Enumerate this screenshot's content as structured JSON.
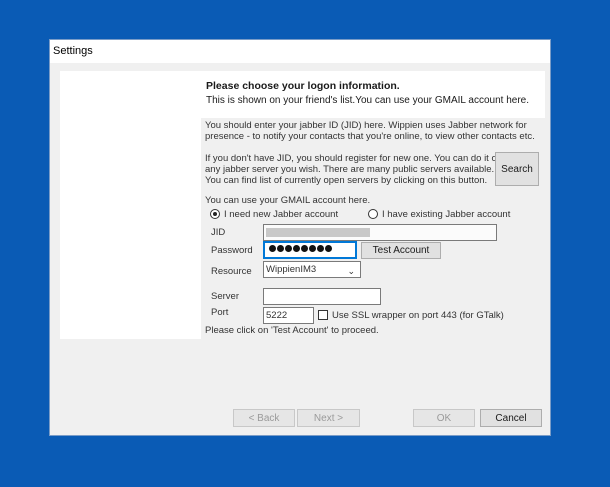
{
  "window": {
    "title": "Settings"
  },
  "header": {
    "title": "Please choose your logon information.",
    "subtitle": "This is shown on your friend's list.You can use your GMAIL account here."
  },
  "intro": {
    "line1": "You should enter your jabber ID (JID) here. Wippien uses Jabber network for",
    "line2": "presence - to notify your contacts that you're online, to view other contacts etc."
  },
  "register": {
    "line1": "If you don't have JID, you should register for new one. You can do it on",
    "line2": "any jabber server you wish. There are many public servers available.",
    "line3": "You can find list of currently open servers by clicking on this button.",
    "search_label": "Search"
  },
  "gmail_note": "You can use your GMAIL account here.",
  "account_choice": {
    "new_label": "I need new Jabber account",
    "existing_label": "I have existing Jabber account",
    "selected": "new"
  },
  "form": {
    "jid_label": "JID",
    "jid_value": "",
    "password_label": "Password",
    "password_length": 8,
    "test_account_label": "Test Account",
    "resource_label": "Resource",
    "resource_value": "WippienIM3",
    "server_label": "Server",
    "server_value": "",
    "port_label": "Port",
    "port_value": "5222",
    "ssl_label": "Use SSL wrapper on port 443 (for GTalk)",
    "ssl_checked": false,
    "hint": "Please click on 'Test Account' to proceed."
  },
  "footer": {
    "back_label": "< Back",
    "next_label": "Next >",
    "ok_label": "OK",
    "cancel_label": "Cancel"
  },
  "colors": {
    "desktop": "#0a5bb5",
    "dialog": "#f0f0f0",
    "focus": "#0078d7"
  }
}
